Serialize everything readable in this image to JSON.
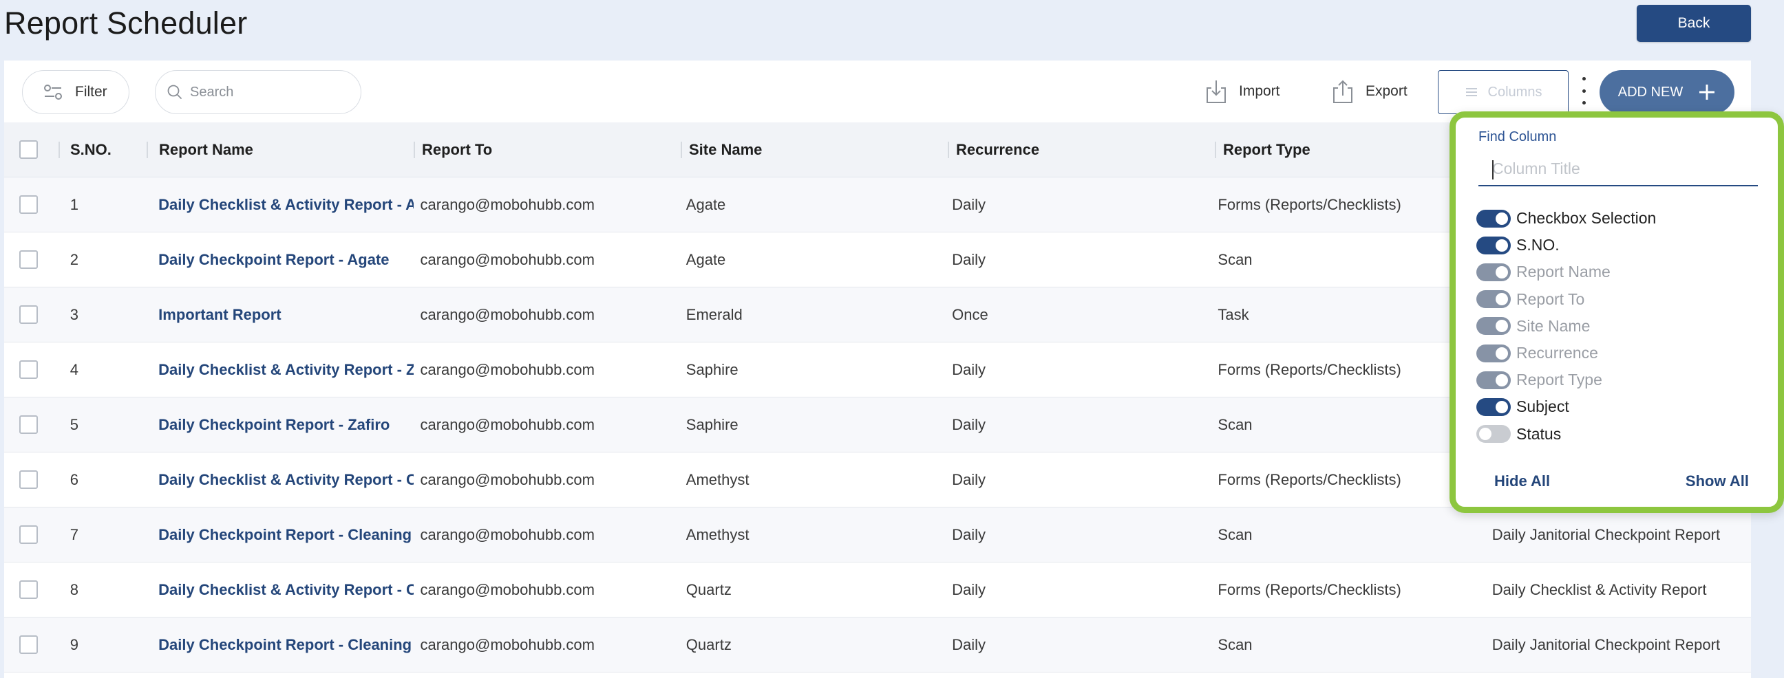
{
  "page": {
    "title": "Report Scheduler",
    "back_label": "Back"
  },
  "toolbar": {
    "filter_label": "Filter",
    "search_placeholder": "Search",
    "import_label": "Import",
    "export_label": "Export",
    "columns_label": "Columns",
    "add_new_label": "ADD NEW"
  },
  "table": {
    "headers": [
      "S.NO.",
      "Report Name",
      "Report To",
      "Site Name",
      "Recurrence",
      "Report Type"
    ],
    "rows": [
      {
        "sno": "1",
        "name": "Daily Checklist & Activity Report - A",
        "to": "carango@mobohubb.com",
        "site": "Agate",
        "recurrence": "Daily",
        "type": "Forms (Reports/Checklists)",
        "subject": ""
      },
      {
        "sno": "2",
        "name": "Daily Checkpoint Report - Agate",
        "to": "carango@mobohubb.com",
        "site": "Agate",
        "recurrence": "Daily",
        "type": "Scan",
        "subject": ""
      },
      {
        "sno": "3",
        "name": "Important Report",
        "to": "carango@mobohubb.com",
        "site": "Emerald",
        "recurrence": "Once",
        "type": "Task",
        "subject": ""
      },
      {
        "sno": "4",
        "name": "Daily Checklist & Activity Report - Z",
        "to": "carango@mobohubb.com",
        "site": "Saphire",
        "recurrence": "Daily",
        "type": "Forms (Reports/Checklists)",
        "subject": ""
      },
      {
        "sno": "5",
        "name": "Daily Checkpoint Report - Zafiro",
        "to": "carango@mobohubb.com",
        "site": "Saphire",
        "recurrence": "Daily",
        "type": "Scan",
        "subject": ""
      },
      {
        "sno": "6",
        "name": "Daily Checklist & Activity Report - C",
        "to": "carango@mobohubb.com",
        "site": "Amethyst",
        "recurrence": "Daily",
        "type": "Forms (Reports/Checklists)",
        "subject": ""
      },
      {
        "sno": "7",
        "name": "Daily Checkpoint Report - Cleaning",
        "to": "carango@mobohubb.com",
        "site": "Amethyst",
        "recurrence": "Daily",
        "type": "Scan",
        "subject": "Daily Janitorial Checkpoint Report"
      },
      {
        "sno": "8",
        "name": "Daily Checklist & Activity Report - C",
        "to": "carango@mobohubb.com",
        "site": "Quartz",
        "recurrence": "Daily",
        "type": "Forms (Reports/Checklists)",
        "subject": "Daily Checklist & Activity Report"
      },
      {
        "sno": "9",
        "name": "Daily Checkpoint Report - Cleaning",
        "to": "carango@mobohubb.com",
        "site": "Quartz",
        "recurrence": "Daily",
        "type": "Scan",
        "subject": "Daily Janitorial Checkpoint Report"
      }
    ]
  },
  "column_picker": {
    "find_label": "Find Column",
    "find_placeholder": "Column Title",
    "options": [
      {
        "label": "Checkbox Selection",
        "state": "on"
      },
      {
        "label": "S.NO.",
        "state": "on"
      },
      {
        "label": "Report Name",
        "state": "on-disabled"
      },
      {
        "label": "Report To",
        "state": "on-disabled"
      },
      {
        "label": "Site Name",
        "state": "on-disabled"
      },
      {
        "label": "Recurrence",
        "state": "on-disabled"
      },
      {
        "label": "Report Type",
        "state": "on-disabled"
      },
      {
        "label": "Subject",
        "state": "on"
      },
      {
        "label": "Status",
        "state": "off"
      }
    ],
    "hide_all_label": "Hide All",
    "show_all_label": "Show All"
  },
  "colors": {
    "primary": "#254a82",
    "popover_border": "#8dc63f",
    "background": "#e8eef8"
  },
  "icons": {
    "filter": "sliders-icon",
    "search": "search-icon",
    "import": "download-icon",
    "export": "upload-icon",
    "columns": "columns-icon",
    "add": "plus-icon",
    "more": "kebab-icon"
  }
}
